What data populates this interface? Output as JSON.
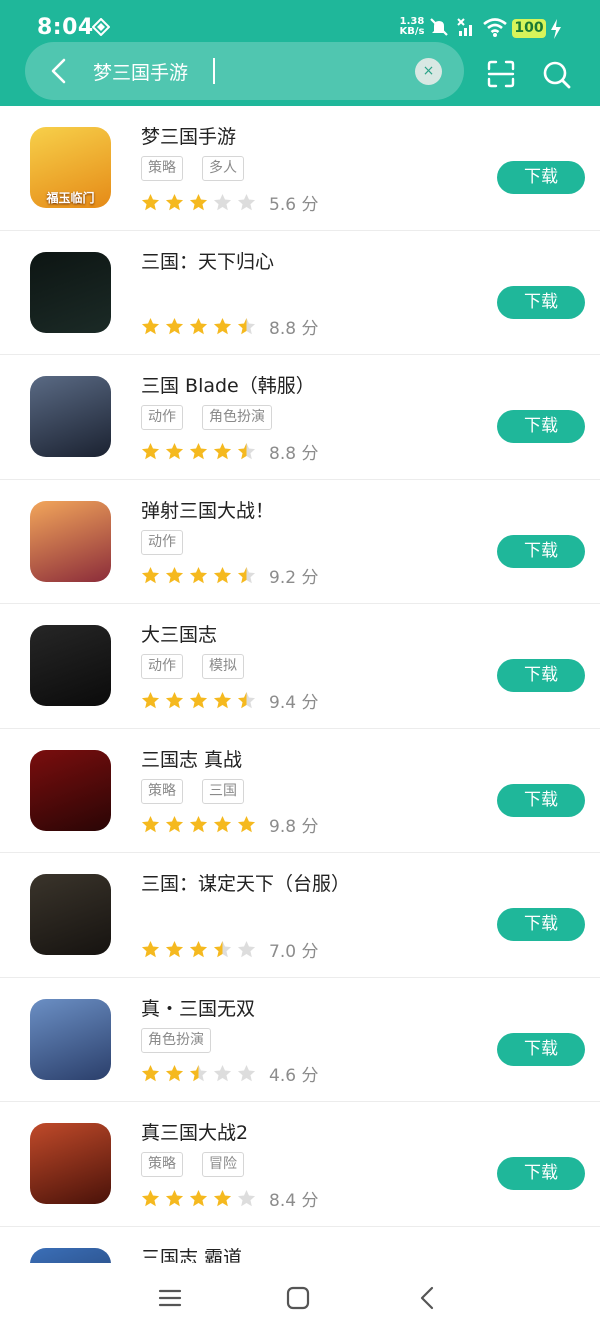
{
  "status": {
    "time": "8:04",
    "net_speed_top": "1.38",
    "net_speed_bottom": "KB/s",
    "battery": "100"
  },
  "search": {
    "query": "梦三国手游",
    "clear_glyph": "×"
  },
  "download_label": "下载",
  "colors": {
    "brand": "#1fb79a",
    "star_on": "#f5b91f",
    "star_off": "#dddddd"
  },
  "apps": [
    {
      "title": "梦三国手游",
      "tags": [
        "策略",
        "多人"
      ],
      "stars": 3,
      "score": "5.6 分",
      "icon": {
        "bg": "linear-gradient(160deg,#f7d04a,#e58a17)",
        "caption": "福玉临门"
      }
    },
    {
      "title": "三国：天下归心",
      "tags": [],
      "stars": 4.5,
      "score": "8.8 分",
      "icon": {
        "bg": "linear-gradient(160deg,#0d1513,#1b2a26)",
        "caption": ""
      }
    },
    {
      "title": "三国 Blade（韩服）",
      "tags": [
        "动作",
        "角色扮演"
      ],
      "stars": 4.5,
      "score": "8.8 分",
      "icon": {
        "bg": "linear-gradient(160deg,#5a6a84,#1b2231)",
        "caption": ""
      }
    },
    {
      "title": "弹射三国大战！",
      "tags": [
        "动作"
      ],
      "stars": 4.5,
      "score": "9.2 分",
      "icon": {
        "bg": "linear-gradient(160deg,#f2a65b,#8b2c3a)",
        "caption": ""
      }
    },
    {
      "title": "大三国志",
      "tags": [
        "动作",
        "模拟"
      ],
      "stars": 4.5,
      "score": "9.4 分",
      "icon": {
        "bg": "linear-gradient(160deg,#262626,#0b0b0b)",
        "caption": ""
      }
    },
    {
      "title": "三国志 真战",
      "tags": [
        "策略",
        "三国"
      ],
      "stars": 5,
      "score": "9.8 分",
      "icon": {
        "bg": "linear-gradient(160deg,#7a0e0e,#2a0505)",
        "caption": ""
      }
    },
    {
      "title": "三国：谋定天下（台服）",
      "tags": [],
      "stars": 3.5,
      "score": "7.0 分",
      "icon": {
        "bg": "linear-gradient(160deg,#3a342b,#161310)",
        "caption": ""
      }
    },
    {
      "title": "真・三国无双",
      "tags": [
        "角色扮演"
      ],
      "stars": 2.5,
      "score": "4.6 分",
      "icon": {
        "bg": "linear-gradient(160deg,#6b8fc4,#2b3f6b)",
        "caption": ""
      }
    },
    {
      "title": "真三国大战2",
      "tags": [
        "策略",
        "冒险"
      ],
      "stars": 4,
      "score": "8.4 分",
      "icon": {
        "bg": "linear-gradient(160deg,#c04a2a,#4a1209)",
        "caption": ""
      }
    },
    {
      "title": "三国志 霸道",
      "tags": [],
      "stars": 0,
      "score": "",
      "icon": {
        "bg": "linear-gradient(160deg,#3b6fb8,#1c3560)",
        "caption": ""
      }
    }
  ]
}
